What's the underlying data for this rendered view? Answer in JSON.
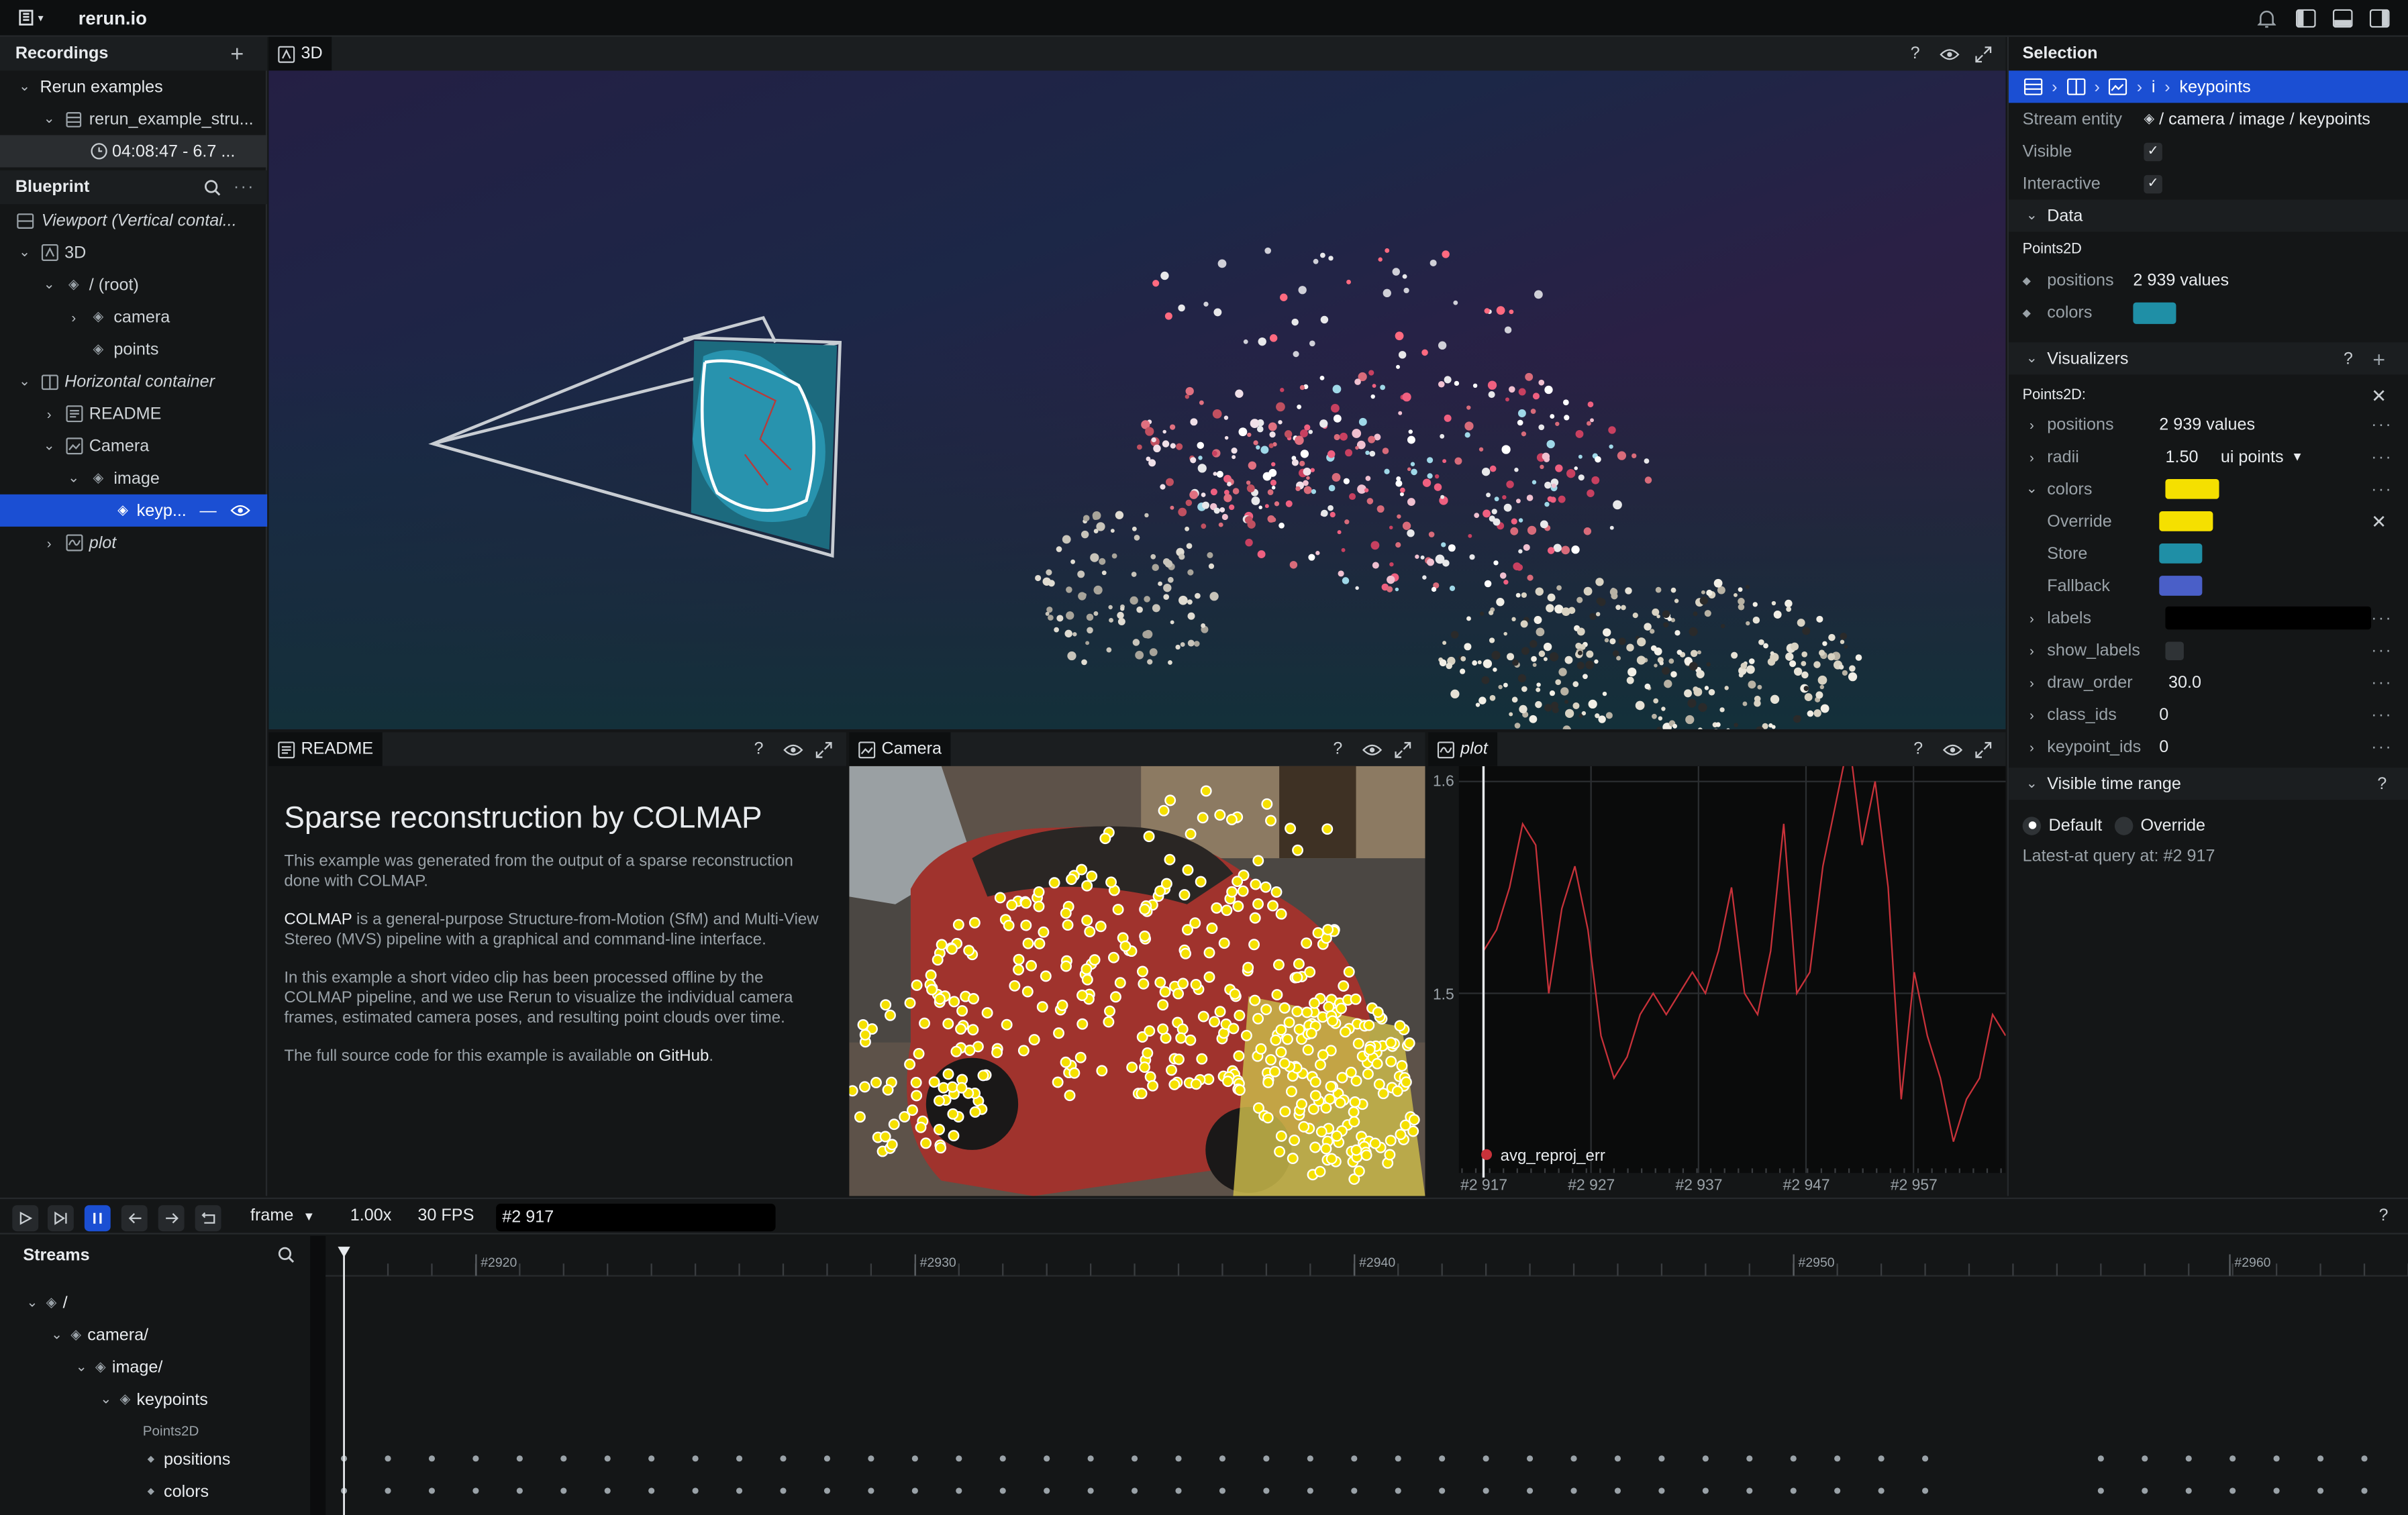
{
  "topbar": {
    "app_title": "rerun.io"
  },
  "recordings": {
    "title": "Recordings",
    "items": [
      {
        "label": "Rerun examples"
      },
      {
        "label": "rerun_example_stru..."
      },
      {
        "label": "04:08:47 - 6.7 ..."
      }
    ]
  },
  "blueprint": {
    "title": "Blueprint",
    "items": [
      {
        "label": "Viewport (Vertical contai..."
      },
      {
        "label": "3D"
      },
      {
        "label": "/ (root)"
      },
      {
        "label": "camera"
      },
      {
        "label": "points"
      },
      {
        "label": "Horizontal container"
      },
      {
        "label": "README"
      },
      {
        "label": "Camera"
      },
      {
        "label": "image"
      },
      {
        "label": "keyp..."
      },
      {
        "label": "plot"
      }
    ]
  },
  "views": {
    "view3d": {
      "tab": "3D"
    },
    "readme": {
      "tab": "README"
    },
    "camera": {
      "tab": "Camera"
    },
    "plot": {
      "tab": "plot"
    }
  },
  "readme": {
    "heading": "Sparse reconstruction by COLMAP",
    "p1": "This example was generated from the output of a sparse reconstruction done with COLMAP.",
    "p2_link": "COLMAP",
    "p2_rest": " is a general-purpose Structure-from-Motion (SfM) and Multi-View Stereo (MVS) pipeline with a graphical and command-line interface.",
    "p3": "In this example a short video clip has been processed offline by the COLMAP pipeline, and we use Rerun to visualize the individual camera frames, estimated camera poses, and resulting point clouds over time.",
    "p4": "The full source code for this example is available ",
    "p4_link": "on GitHub",
    "p4_end": "."
  },
  "selection": {
    "title": "Selection",
    "breadcrumb_i": "i",
    "breadcrumb_last": "keypoints",
    "stream_entity_label": "Stream entity",
    "stream_entity_value": "/ camera / image / keypoints",
    "visible_label": "Visible",
    "interactive_label": "Interactive",
    "data_header": "Data",
    "data_archetype": "Points2D",
    "data_positions_label": "positions",
    "data_positions_value": "2 939 values",
    "data_colors_label": "colors",
    "visualizers_header": "Visualizers",
    "vis_archetype": "Points2D:",
    "vis_rows": [
      {
        "label": "positions",
        "value": "2 939 values"
      },
      {
        "label": "radii",
        "value": "1.50",
        "unit": "ui points"
      },
      {
        "label": "colors"
      },
      {
        "label": "Override"
      },
      {
        "label": "Store"
      },
      {
        "label": "Fallback"
      },
      {
        "label": "labels"
      },
      {
        "label": "show_labels"
      },
      {
        "label": "draw_order",
        "value": "30.0"
      },
      {
        "label": "class_ids",
        "value": "0"
      },
      {
        "label": "keypoint_ids",
        "value": "0"
      }
    ],
    "time_range_header": "Visible time range",
    "default_label": "Default",
    "override_label": "Override",
    "latest_at": "Latest-at query at: #2 917",
    "colors": {
      "data": "#1f8fa6",
      "override": "#f5e000",
      "store": "#1f8fa6",
      "fallback": "#4a5fc8"
    }
  },
  "plot": {
    "series_name": "avg_reproj_err",
    "y_ticks": [
      "1.6",
      "1.5"
    ],
    "x_ticks": [
      "#2 917",
      "#2 927",
      "#2 937",
      "#2 947",
      "#2 957"
    ],
    "color": "#c8323a"
  },
  "timeline": {
    "timeline_name": "frame",
    "speed": "1.00x",
    "fps": "30 FPS",
    "current": "#2 917",
    "streams_title": "Streams",
    "tree": [
      {
        "label": "/"
      },
      {
        "label": "camera/"
      },
      {
        "label": "image/"
      },
      {
        "label": "keypoints"
      },
      {
        "label": "Points2D"
      },
      {
        "label": "positions"
      },
      {
        "label": "colors"
      }
    ],
    "ruler": [
      "#2920",
      "#2930",
      "#2940",
      "#2950",
      "#2960"
    ]
  }
}
